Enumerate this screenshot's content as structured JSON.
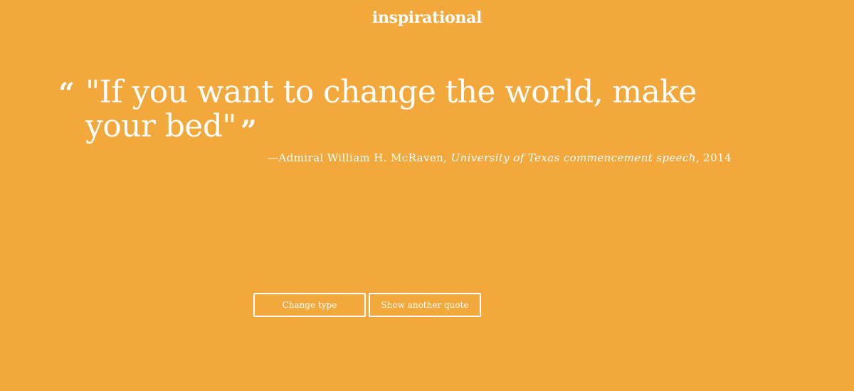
{
  "theme": {
    "background": "#F2A83B",
    "foreground": "#FFFFFF"
  },
  "header": {
    "category": "inspirational"
  },
  "quote": {
    "open_mark": "“",
    "text": "\"If you want to change the world, make your bed\"",
    "close_mark": "”",
    "attribution_prefix": "—Admiral William H. McRaven, ",
    "source": "University of Texas commencement speech",
    "attribution_suffix": ", 2014"
  },
  "actions": {
    "change_type_label": "Change type",
    "another_quote_label": "Show another quote"
  }
}
